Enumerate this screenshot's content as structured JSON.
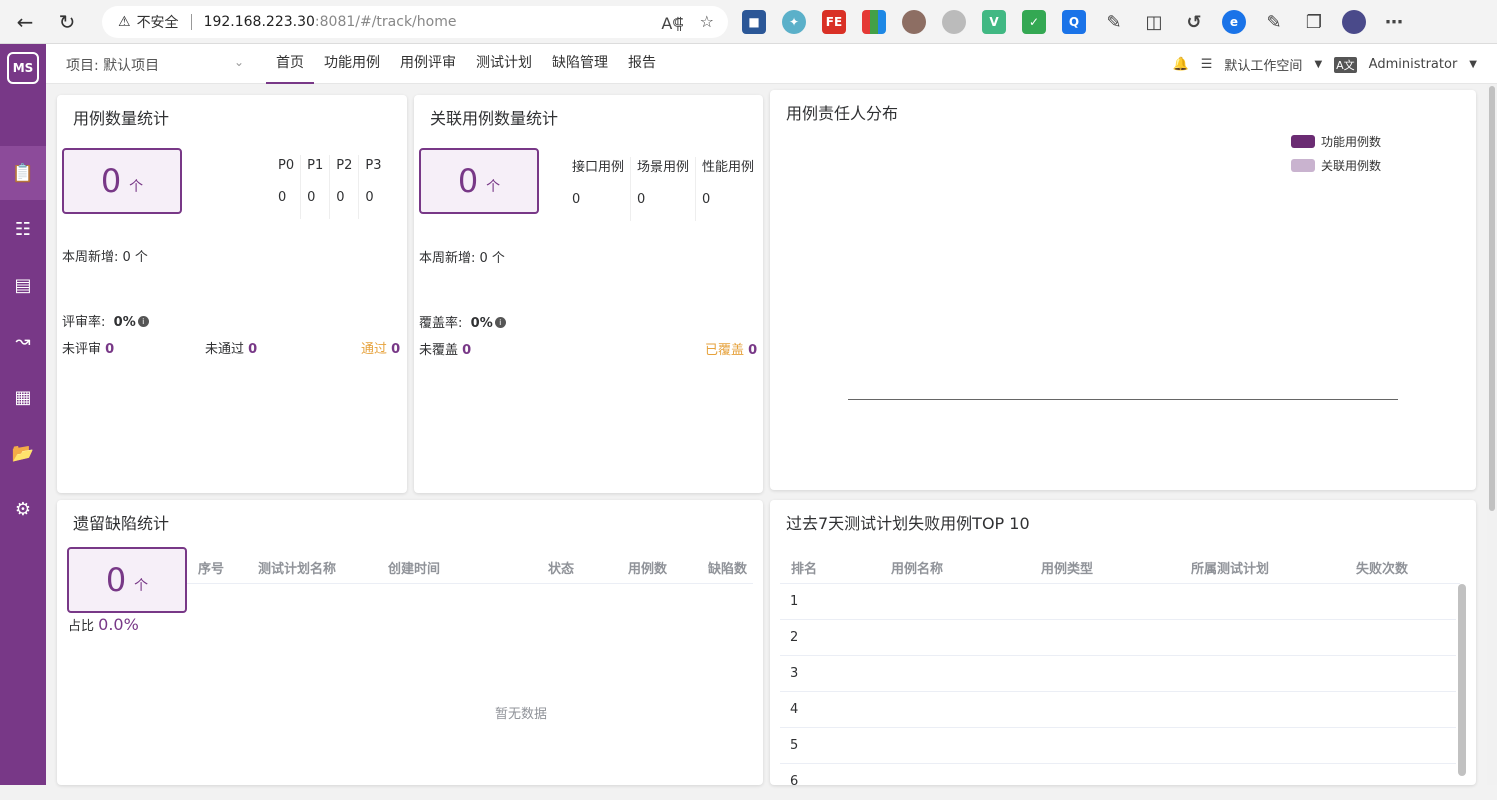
{
  "browser": {
    "insecure": "不安全",
    "url_host": "192.168.223.30",
    "url_path": ":8081/#/track/home"
  },
  "nav": {
    "project": "项目: 默认项目",
    "menu": [
      "首页",
      "功能用例",
      "用例评审",
      "测试计划",
      "缺陷管理",
      "报告"
    ],
    "workspace": "默认工作空间",
    "user": "Administrator"
  },
  "case_stats": {
    "title": "用例数量统计",
    "count": "0",
    "unit": "个",
    "priorities": [
      {
        "label": "P0",
        "value": "0"
      },
      {
        "label": "P1",
        "value": "0"
      },
      {
        "label": "P2",
        "value": "0"
      },
      {
        "label": "P3",
        "value": "0"
      }
    ],
    "weekly_label": "本周新增:",
    "weekly_value": "0 个",
    "review_rate_label": "评审率:",
    "review_rate": "0%",
    "unreviewed_label": "未评审",
    "unreviewed": "0",
    "not_passed_label": "未通过",
    "not_passed": "0",
    "passed_label": "通过",
    "passed": "0"
  },
  "related_stats": {
    "title": "关联用例数量统计",
    "count": "0",
    "unit": "个",
    "types": [
      {
        "label": "接口用例",
        "value": "0"
      },
      {
        "label": "场景用例",
        "value": "0"
      },
      {
        "label": "性能用例",
        "value": "0"
      }
    ],
    "weekly_label": "本周新增:",
    "weekly_value": "0 个",
    "coverage_label": "覆盖率:",
    "coverage": "0%",
    "uncovered_label": "未覆盖",
    "uncovered": "0",
    "covered_label": "已覆盖",
    "covered": "0"
  },
  "owner_dist": {
    "title": "用例责任人分布",
    "legend": [
      {
        "name": "功能用例数",
        "color": "#6b2c73"
      },
      {
        "name": "关联用例数",
        "color": "#c9b3cf"
      }
    ]
  },
  "defects": {
    "title": "遗留缺陷统计",
    "count": "0",
    "unit": "个",
    "ratio_label": "占比",
    "ratio": "0.0%",
    "columns": [
      "序号",
      "测试计划名称",
      "创建时间",
      "状态",
      "用例数",
      "缺陷数"
    ],
    "empty": "暂无数据"
  },
  "top10": {
    "title": "过去7天测试计划失败用例TOP 10",
    "columns": [
      "排名",
      "用例名称",
      "用例类型",
      "所属测试计划",
      "失败次数"
    ],
    "ranks": [
      "1",
      "2",
      "3",
      "4",
      "5",
      "6"
    ]
  },
  "colors": {
    "brand": "#783887",
    "accent_orange": "#e6a23c"
  }
}
